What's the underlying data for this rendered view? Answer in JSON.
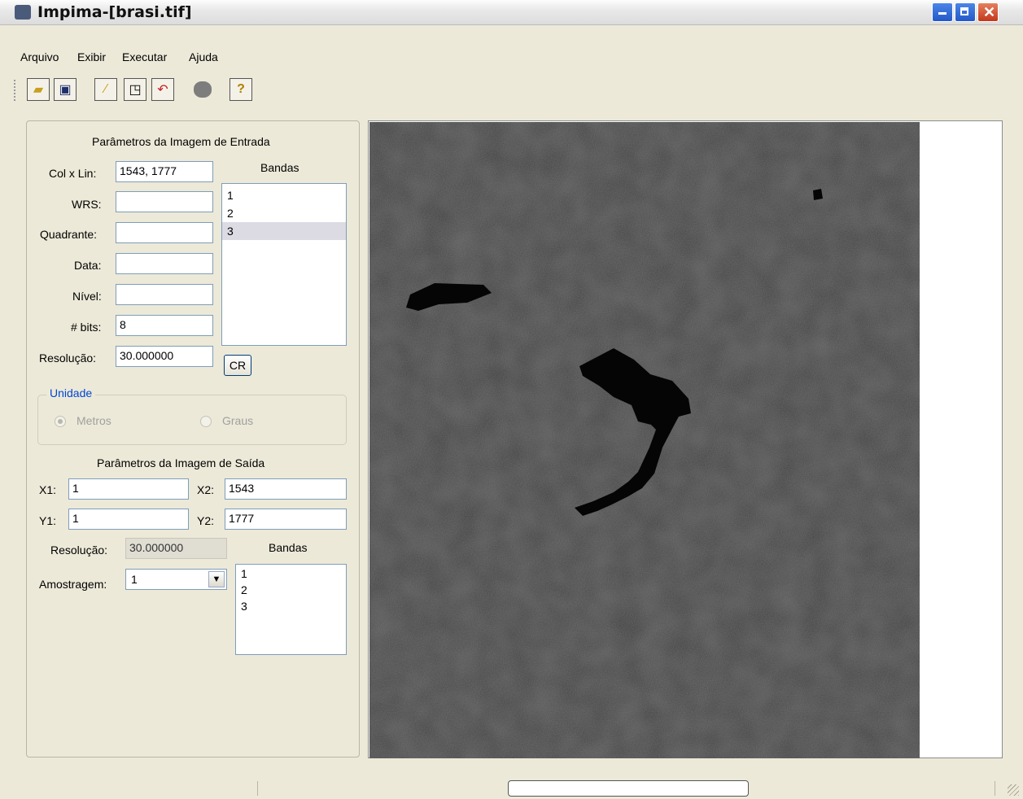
{
  "window": {
    "title": "Impima-[brasi.tif]"
  },
  "menu": [
    "Arquivo",
    "Exibir",
    "Executar",
    "Ajuda"
  ],
  "toolbar_icons": [
    "open-folder-icon",
    "save-icon",
    "edit-icon",
    "export-icon",
    "undo-icon",
    "blob-icon",
    "help-icon"
  ],
  "input_params": {
    "title": "Parâmetros da Imagem de Entrada",
    "col_lin_label": "Col x Lin:",
    "col_lin_value": "1543, 1777",
    "wrs_label": "WRS:",
    "wrs_value": "",
    "quadrante_label": "Quadrante:",
    "quadrante_value": "",
    "data_label": "Data:",
    "data_value": "",
    "nivel_label": "Nível:",
    "nivel_value": "",
    "bits_label": "# bits:",
    "bits_value": "8",
    "resolucao_label": "Resolução:",
    "resolucao_value": "30.000000",
    "bandas_label": "Bandas",
    "bandas": [
      "1",
      "2",
      "3"
    ],
    "cr_button": "CR"
  },
  "unidade": {
    "title": "Unidade",
    "metros": "Metros",
    "graus": "Graus"
  },
  "output_params": {
    "title": "Parâmetros da Imagem de Saída",
    "x1_label": "X1:",
    "x1_value": "1",
    "x2_label": "X2:",
    "x2_value": "1543",
    "y1_label": "Y1:",
    "y1_value": "1",
    "y2_label": "Y2:",
    "y2_value": "1777",
    "resolucao_label": "Resolução:",
    "resolucao_value": "30.000000",
    "bandas_label": "Bandas",
    "bandas": [
      "1",
      "2",
      "3"
    ],
    "amostragem_label": "Amostragem:",
    "amostragem_value": "1"
  },
  "colors": {
    "accent": "#0046d5",
    "list_selected": "#dcdbe3",
    "image_bg": "#3c3c3c",
    "water": "#050505"
  }
}
